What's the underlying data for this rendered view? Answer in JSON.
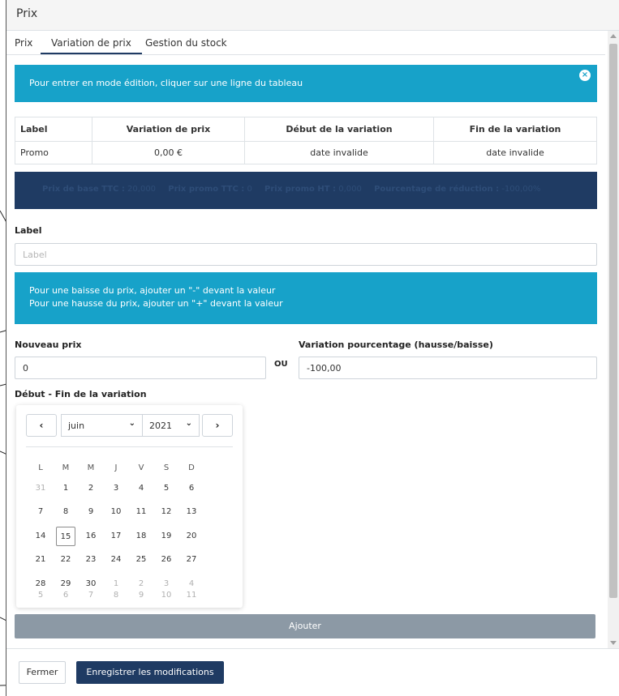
{
  "modal": {
    "title": "Prix"
  },
  "tabs": [
    {
      "label": "Prix"
    },
    {
      "label": "Variation de prix"
    },
    {
      "label": "Gestion du stock"
    }
  ],
  "info_alert": {
    "text": "Pour entrer en mode édition, cliquer sur une ligne du tableau",
    "close": "×"
  },
  "table": {
    "headers": [
      "Label",
      "Variation de prix",
      "Début de la variation",
      "Fin de la variation"
    ],
    "rows": [
      [
        "Promo",
        "0,00 €",
        "date invalide",
        "date invalide"
      ]
    ]
  },
  "summary": {
    "base_ttc_label": "Prix de base TTC :",
    "base_ttc_value": "20,000",
    "promo_ttc_label": "Prix promo TTC :",
    "promo_ttc_value": "0",
    "promo_ht_label": "Prix promo HT :",
    "promo_ht_value": "0,000",
    "reduction_label": "Pourcentage de réduction :",
    "reduction_value": "-100,00%"
  },
  "form": {
    "label_field": {
      "label": "Label",
      "placeholder": "Label"
    },
    "hint": {
      "line1": "Pour une baisse du prix, ajouter un \"-\" devant la valeur",
      "line2": "Pour une hausse du prix, ajouter un \"+\" devant la valeur"
    },
    "new_price": {
      "label": "Nouveau prix",
      "value": "0"
    },
    "or_text": "OU",
    "percent": {
      "label": "Variation pourcentage (hausse/baisse)",
      "value": "-100,00"
    },
    "date_range_label": "Début - Fin de la variation",
    "add_button": "Ajouter"
  },
  "calendar": {
    "prev": "‹",
    "next": "›",
    "month": "juin",
    "year": "2021",
    "weekdays": [
      "L",
      "M",
      "M",
      "J",
      "V",
      "S",
      "D"
    ],
    "weeks": [
      [
        "31",
        "1",
        "2",
        "3",
        "4",
        "5",
        "6"
      ],
      [
        "7",
        "8",
        "9",
        "10",
        "11",
        "12",
        "13"
      ],
      [
        "14",
        "15",
        "16",
        "17",
        "18",
        "19",
        "20"
      ],
      [
        "21",
        "22",
        "23",
        "24",
        "25",
        "26",
        "27"
      ],
      [
        "28",
        "29",
        "30",
        "1",
        "2",
        "3",
        "4"
      ],
      [
        "5",
        "6",
        "7",
        "8",
        "9",
        "10",
        "11"
      ]
    ],
    "today": "15"
  },
  "footer": {
    "close_button": "Fermer",
    "save_button": "Enregistrer les modifications"
  }
}
